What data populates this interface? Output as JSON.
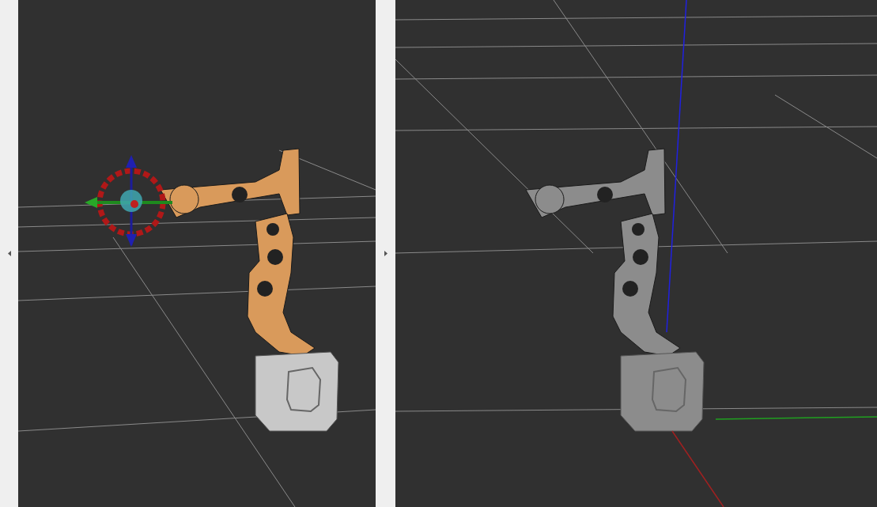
{
  "viewports": [
    {
      "kind": "marker"
    },
    {
      "kind": "axes"
    }
  ]
}
